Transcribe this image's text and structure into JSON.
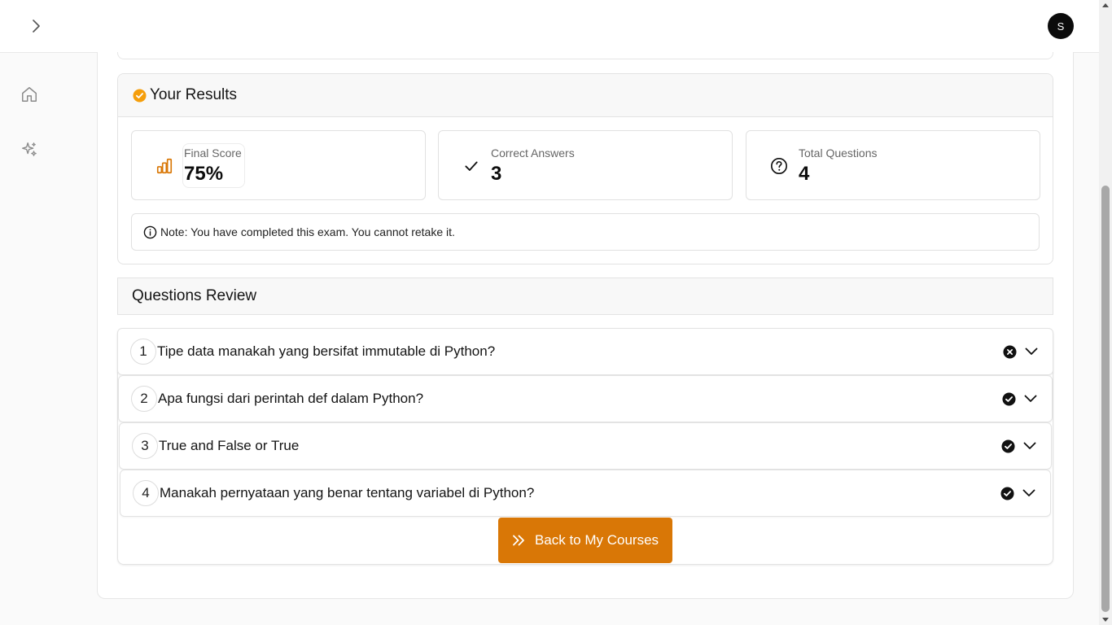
{
  "header": {
    "avatar_initial": "S"
  },
  "sidenav": {
    "items": [
      {
        "icon": "home-icon"
      },
      {
        "icon": "sparkles-icon"
      }
    ]
  },
  "results": {
    "title": "Your Results",
    "stats": {
      "final_score": {
        "label": "Final Score",
        "value": "75%",
        "icon": "bar-chart-icon"
      },
      "correct_answers": {
        "label": "Correct Answers",
        "value": "3",
        "icon": "check-icon"
      },
      "total_questions": {
        "label": "Total Questions",
        "value": "4",
        "icon": "question-circle-icon"
      }
    },
    "note": "Note: You have completed this exam. You cannot retake it."
  },
  "review": {
    "title": "Questions Review",
    "questions": [
      {
        "number": "1",
        "text": "Tipe data manakah yang bersifat immutable di Python?",
        "status": "incorrect"
      },
      {
        "number": "2",
        "text": "Apa fungsi dari perintah def dalam Python?",
        "status": "correct"
      },
      {
        "number": "3",
        "text": "True and False or True",
        "status": "correct"
      },
      {
        "number": "4",
        "text": "Manakah pernyataan yang benar tentang variabel di Python?",
        "status": "correct"
      }
    ]
  },
  "back_button": {
    "label": "Back to My Courses"
  },
  "colors": {
    "accent": "#d97706",
    "results_icon": "#f59e0b"
  }
}
